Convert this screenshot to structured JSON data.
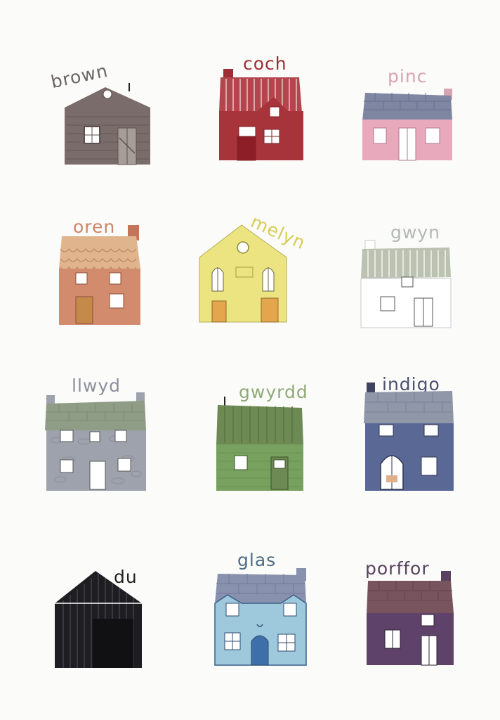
{
  "houses": [
    {
      "label": "brown",
      "label_color": "#6b6462",
      "wall": "#7a6c6a",
      "roof": "#7a6c6a",
      "door": "#a79d98"
    },
    {
      "label": "coch",
      "label_color": "#9e2e34",
      "wall": "#a7343b",
      "roof": "#b4454d",
      "door": "#8d1d27"
    },
    {
      "label": "pinc",
      "label_color": "#d8a3b3",
      "wall": "#e8a9bd",
      "roof": "#7f86a2",
      "door": "#ffffff"
    },
    {
      "label": "oren",
      "label_color": "#cd8669",
      "wall": "#d38b6d",
      "roof": "#e0b58e",
      "door": "#c58a4a"
    },
    {
      "label": "melyn",
      "label_color": "#d9cc58",
      "wall": "#ebe481",
      "roof": "#ebe481",
      "door": "#e4a64c"
    },
    {
      "label": "gwyn",
      "label_color": "#b4b8b8",
      "wall": "#ffffff",
      "roof": "#bcc2b1",
      "door": "#ffffff"
    },
    {
      "label": "llwyd",
      "label_color": "#8c8f9c",
      "wall": "#9ea2ac",
      "roof": "#8f9d86",
      "door": "#ffffff"
    },
    {
      "label": "gwyrdd",
      "label_color": "#8faa78",
      "wall": "#78a05e",
      "roof": "#6d8a55",
      "door": "#6d8a55"
    },
    {
      "label": "indigo",
      "label_color": "#4b5270",
      "wall": "#5a6896",
      "roof": "#8f97a8",
      "door": "#ffffff"
    },
    {
      "label": "du",
      "label_color": "#222222",
      "wall": "#1e1e22",
      "roof": "#1e1e22",
      "door": "#111114"
    },
    {
      "label": "glas",
      "label_color": "#4d6b83",
      "wall": "#9ec9dd",
      "roof": "#8891ad",
      "door": "#3e6fa8"
    },
    {
      "label": "porffor",
      "label_color": "#59425f",
      "wall": "#5f4269",
      "roof": "#77545e",
      "door": "#ffffff"
    }
  ]
}
